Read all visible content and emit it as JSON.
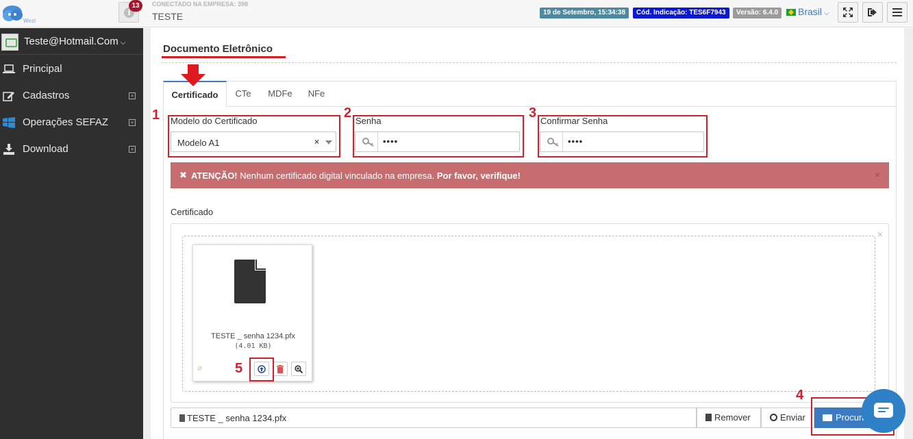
{
  "header": {
    "notification_count": "13",
    "company_label": "CONECTADO NA EMPRESA: 398",
    "company_name": "TESTE",
    "date_badge": "19 de Setembro, 15:34:38",
    "code_badge": "Cód. Indicação: TES6F7943",
    "version_badge": "Versão: 6.4.0",
    "language": "Brasil",
    "logo_text": "Wezi"
  },
  "sidebar": {
    "user": "Teste@Hotmail.Com",
    "items": [
      {
        "label": "Principal",
        "icon": "laptop-icon",
        "expandable": false
      },
      {
        "label": "Cadastros",
        "icon": "edit-icon",
        "expandable": true
      },
      {
        "label": "Operações SEFAZ",
        "icon": "windows-icon",
        "expandable": true
      },
      {
        "label": "Download",
        "icon": "download-icon",
        "expandable": true
      }
    ]
  },
  "page": {
    "title": "Documento Eletrônico",
    "tabs": [
      "Certificado",
      "CTe",
      "MDFe",
      "NFe"
    ],
    "active_tab": "Certificado"
  },
  "form": {
    "model_label": "Modelo do Certificado",
    "model_value": "Modelo A1",
    "password_label": "Senha",
    "password_value": "••••",
    "confirm_label": "Confirmar Senha",
    "confirm_value": "••••"
  },
  "alert": {
    "prefix": "ATENÇÃO!",
    "message": " Nenhum certificado digital vinculado na empresa. ",
    "suffix": "Por favor, verifique!"
  },
  "upload": {
    "section_label": "Certificado",
    "file_name": "TESTE _ senha 1234.pfx",
    "file_size": "(4.01 KB)",
    "selected_file": "TESTE _ senha 1234.pfx",
    "remove_label": "Remover",
    "send_label": "Enviar",
    "browse_label": "Procurar"
  },
  "annotations": {
    "steps": [
      "1",
      "2",
      "3",
      "4",
      "5"
    ],
    "highlight_color": "#d0202d"
  },
  "colors": {
    "accent": "#3c7ac2",
    "sidebar_bg": "#2f2f2f",
    "alert_bg": "#c86d6f"
  }
}
